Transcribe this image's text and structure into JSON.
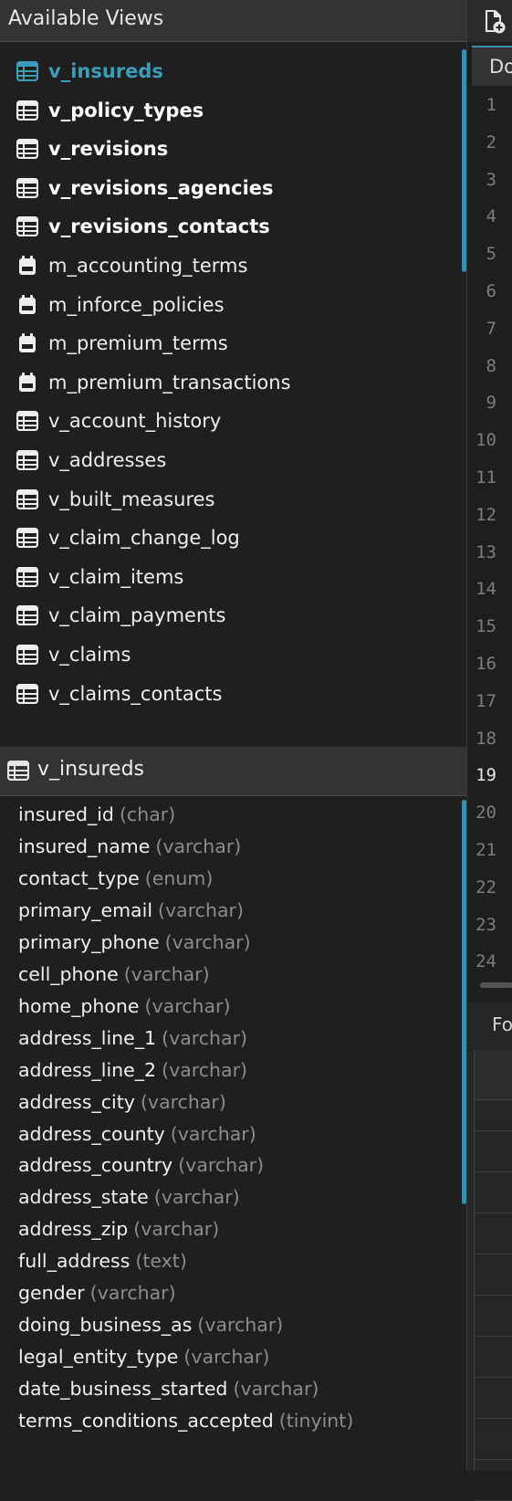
{
  "views_panel": {
    "title": "Available Views",
    "items": [
      {
        "label": "v_insureds",
        "kind": "view",
        "style": "active"
      },
      {
        "label": "v_policy_types",
        "kind": "view",
        "style": "bold"
      },
      {
        "label": "v_revisions",
        "kind": "view",
        "style": "bold"
      },
      {
        "label": "v_revisions_agencies",
        "kind": "view",
        "style": "bold"
      },
      {
        "label": "v_revisions_contacts",
        "kind": "view",
        "style": "bold"
      },
      {
        "label": "m_accounting_terms",
        "kind": "materialized",
        "style": "normal"
      },
      {
        "label": "m_inforce_policies",
        "kind": "materialized",
        "style": "normal"
      },
      {
        "label": "m_premium_terms",
        "kind": "materialized",
        "style": "normal"
      },
      {
        "label": "m_premium_transactions",
        "kind": "materialized",
        "style": "normal"
      },
      {
        "label": "v_account_history",
        "kind": "view",
        "style": "normal"
      },
      {
        "label": "v_addresses",
        "kind": "view",
        "style": "normal"
      },
      {
        "label": "v_built_measures",
        "kind": "view",
        "style": "normal"
      },
      {
        "label": "v_claim_change_log",
        "kind": "view",
        "style": "normal"
      },
      {
        "label": "v_claim_items",
        "kind": "view",
        "style": "normal"
      },
      {
        "label": "v_claim_payments",
        "kind": "view",
        "style": "normal"
      },
      {
        "label": "v_claims",
        "kind": "view",
        "style": "normal"
      },
      {
        "label": "v_claims_contacts",
        "kind": "view",
        "style": "normal"
      }
    ]
  },
  "table_panel": {
    "title": "v_insureds",
    "columns": [
      {
        "name": "insured_id",
        "type": "(char)"
      },
      {
        "name": "insured_name",
        "type": "(varchar)"
      },
      {
        "name": "contact_type",
        "type": "(enum)"
      },
      {
        "name": "primary_email",
        "type": "(varchar)"
      },
      {
        "name": "primary_phone",
        "type": "(varchar)"
      },
      {
        "name": "cell_phone",
        "type": "(varchar)"
      },
      {
        "name": "home_phone",
        "type": "(varchar)"
      },
      {
        "name": "address_line_1",
        "type": "(varchar)"
      },
      {
        "name": "address_line_2",
        "type": "(varchar)"
      },
      {
        "name": "address_city",
        "type": "(varchar)"
      },
      {
        "name": "address_county",
        "type": "(varchar)"
      },
      {
        "name": "address_country",
        "type": "(varchar)"
      },
      {
        "name": "address_state",
        "type": "(varchar)"
      },
      {
        "name": "address_zip",
        "type": "(varchar)"
      },
      {
        "name": "full_address",
        "type": "(text)"
      },
      {
        "name": "gender",
        "type": "(varchar)"
      },
      {
        "name": "doing_business_as",
        "type": "(varchar)"
      },
      {
        "name": "legal_entity_type",
        "type": "(varchar)"
      },
      {
        "name": "date_business_started",
        "type": "(varchar)"
      },
      {
        "name": "terms_conditions_accepted",
        "type": "(tinyint)"
      }
    ]
  },
  "editor": {
    "tab_label": "Do",
    "line_numbers": [
      "1",
      "2",
      "3",
      "4",
      "5",
      "6",
      "7",
      "8",
      "9",
      "10",
      "11",
      "12",
      "13",
      "14",
      "15",
      "16",
      "17",
      "18",
      "19",
      "20",
      "21",
      "22",
      "23",
      "24"
    ],
    "current_line": "19",
    "bottom_tab_label": "Fo"
  },
  "colors": {
    "accent": "#3d9db8",
    "scrollbar": "#3a8fab",
    "panel_header": "#333333",
    "background": "#1f1f1f",
    "type_text": "#8c8c8c"
  },
  "icons": {
    "view": "table-view-icon",
    "materialized": "calendar-icon",
    "new_file": "new-file-icon"
  }
}
